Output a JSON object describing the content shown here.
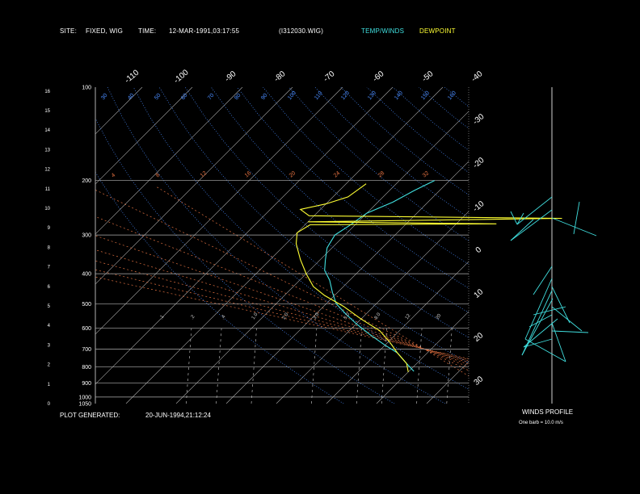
{
  "header": {
    "site_label": "SITE:",
    "site_value": "FIXED, WIG",
    "time_label": "TIME:",
    "time_value": "12-MAR-1991,03:17:55",
    "file_value": "(I312030.WIG)",
    "legend_temp_winds": "TEMP/WINDS",
    "legend_dewpoint": "DEWPOINT"
  },
  "footer": {
    "plot_generated_label": "PLOT GENERATED:",
    "plot_generated_value": "20-JUN-1994,21:12:24",
    "winds_title": "WINDS PROFILE",
    "barb_note": "One barb = 10.0 m/s"
  },
  "colors": {
    "background": "#000000",
    "temp_winds": "#40e0e0",
    "dewpoint": "#ffff33",
    "grid": "#b0b0b0",
    "dry_adiabat": "#4a8cff",
    "moist_adiabat": "#e07040",
    "mixing_ratio": "#d0d0d0"
  },
  "chart_data": {
    "type": "line",
    "pressure_levels": [
      {
        "p": 100,
        "label": "100"
      },
      {
        "p": 200,
        "label": "200"
      },
      {
        "p": 300,
        "label": "300"
      },
      {
        "p": 400,
        "label": "400"
      },
      {
        "p": 500,
        "label": "500"
      },
      {
        "p": 600,
        "label": "600"
      },
      {
        "p": 700,
        "label": "700"
      },
      {
        "p": 800,
        "label": "800"
      },
      {
        "p": 900,
        "label": "900"
      },
      {
        "p": 1000,
        "label": "1000"
      },
      {
        "p": 1050,
        "label": "1050"
      }
    ],
    "height_ticks": [
      {
        "h": 16,
        "label": "16"
      },
      {
        "h": 15,
        "label": "15"
      },
      {
        "h": 14,
        "label": "14"
      },
      {
        "h": 13,
        "label": "13"
      },
      {
        "h": 12,
        "label": "12"
      },
      {
        "h": 11,
        "label": "11"
      },
      {
        "h": 10,
        "label": "10"
      },
      {
        "h": 9,
        "label": "9"
      },
      {
        "h": 8,
        "label": "8"
      },
      {
        "h": 7,
        "label": "7"
      },
      {
        "h": 6,
        "label": "6"
      },
      {
        "h": 5,
        "label": "5"
      },
      {
        "h": 4,
        "label": "4"
      },
      {
        "h": 3,
        "label": "3"
      },
      {
        "h": 2,
        "label": "2"
      },
      {
        "h": 1,
        "label": "1"
      },
      {
        "h": 0,
        "label": "0"
      }
    ],
    "top_isotherm_labels": [
      "-110",
      "-100",
      "-90",
      "-80",
      "-70",
      "-60",
      "-50",
      "-40"
    ],
    "right_isotherm_labels": [
      "-30",
      "-20",
      "-10",
      "0",
      "10",
      "20",
      "30"
    ],
    "dry_adiabat_labels": [
      "30",
      "40",
      "50",
      "60",
      "70",
      "80",
      "90",
      "100",
      "110",
      "120",
      "130",
      "140",
      "150",
      "160"
    ],
    "moist_adiabat_labels": [
      "4",
      "8",
      "12",
      "16",
      "20",
      "24",
      "28",
      "32"
    ],
    "mixing_ratio_labels": [
      ".1",
      ".2",
      ".4",
      "1.0",
      "2.0",
      "3.0",
      "5.0",
      "8.0",
      "12",
      "20"
    ],
    "series": [
      {
        "name": "TEMP/WINDS",
        "points": [
          {
            "p": 826,
            "t": -19
          },
          {
            "p": 780,
            "t": -22
          },
          {
            "p": 720,
            "t": -26
          },
          {
            "p": 680,
            "t": -30
          },
          {
            "p": 630,
            "t": -35
          },
          {
            "p": 580,
            "t": -40
          },
          {
            "p": 540,
            "t": -44
          },
          {
            "p": 500,
            "t": -48
          },
          {
            "p": 460,
            "t": -51
          },
          {
            "p": 420,
            "t": -54
          },
          {
            "p": 390,
            "t": -57
          },
          {
            "p": 360,
            "t": -59
          },
          {
            "p": 330,
            "t": -61
          },
          {
            "p": 300,
            "t": -62
          },
          {
            "p": 280,
            "t": -61
          },
          {
            "p": 255,
            "t": -60
          },
          {
            "p": 235,
            "t": -57
          },
          {
            "p": 215,
            "t": -55
          },
          {
            "p": 200,
            "t": -53
          }
        ]
      },
      {
        "name": "DEWPOINT",
        "points": [
          {
            "p": 830,
            "t": -20
          },
          {
            "p": 780,
            "t": -22
          },
          {
            "p": 720,
            "t": -26
          },
          {
            "p": 660,
            "t": -30
          },
          {
            "p": 610,
            "t": -34
          },
          {
            "p": 560,
            "t": -40
          },
          {
            "p": 510,
            "t": -46
          },
          {
            "p": 470,
            "t": -52
          },
          {
            "p": 440,
            "t": -56
          },
          {
            "p": 400,
            "t": -60
          },
          {
            "p": 360,
            "t": -64
          },
          {
            "p": 320,
            "t": -68
          },
          {
            "p": 295,
            "t": -70
          },
          {
            "p": 278,
            "t": -69
          },
          {
            "p": 276,
            "t": -32
          },
          {
            "p": 272,
            "t": -70
          },
          {
            "p": 265,
            "t": -20
          },
          {
            "p": 260,
            "t": -71
          },
          {
            "p": 248,
            "t": -74
          },
          {
            "p": 238,
            "t": -70
          },
          {
            "p": 226,
            "t": -67
          },
          {
            "p": 205,
            "t": -66
          }
        ]
      }
    ]
  }
}
